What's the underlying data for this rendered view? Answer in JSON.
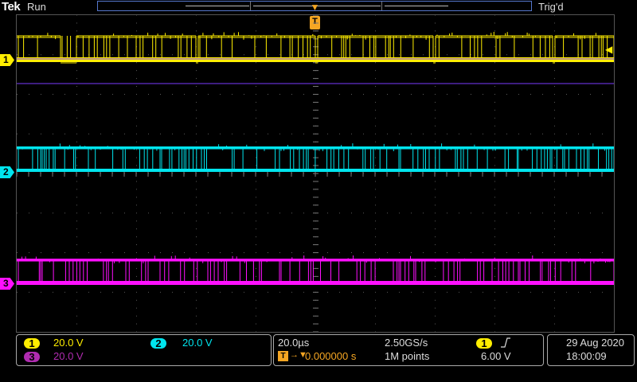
{
  "header": {
    "brand": "Tek",
    "run_state": "Run",
    "trigger_state": "Trig'd"
  },
  "markers": {
    "trigger_label": "T",
    "trigger_position_label": "T"
  },
  "channels": [
    {
      "id": "1",
      "color": "#ffee00",
      "name": "ch1"
    },
    {
      "id": "2",
      "color": "#00e5ee",
      "name": "ch2"
    },
    {
      "id": "3",
      "color": "#ff10ff",
      "name": "ch3"
    }
  ],
  "vertical_panel": {
    "ch1": {
      "badge": "1",
      "scale": "20.0 V"
    },
    "ch2": {
      "badge": "2",
      "scale": "20.0 V"
    },
    "ch3": {
      "badge": "3",
      "scale": "20.0 V"
    }
  },
  "horizontal_panel": {
    "time_per_div": "20.0µs",
    "sample_rate": "2.50GS/s",
    "trigger_delay": "0.000000 s",
    "record_length": "1M points"
  },
  "trigger_panel": {
    "source": "1",
    "slope_icon": "rising-edge",
    "level": "6.00 V"
  },
  "datetime": {
    "date": "29 Aug 2020",
    "time": "18:00:09"
  }
}
